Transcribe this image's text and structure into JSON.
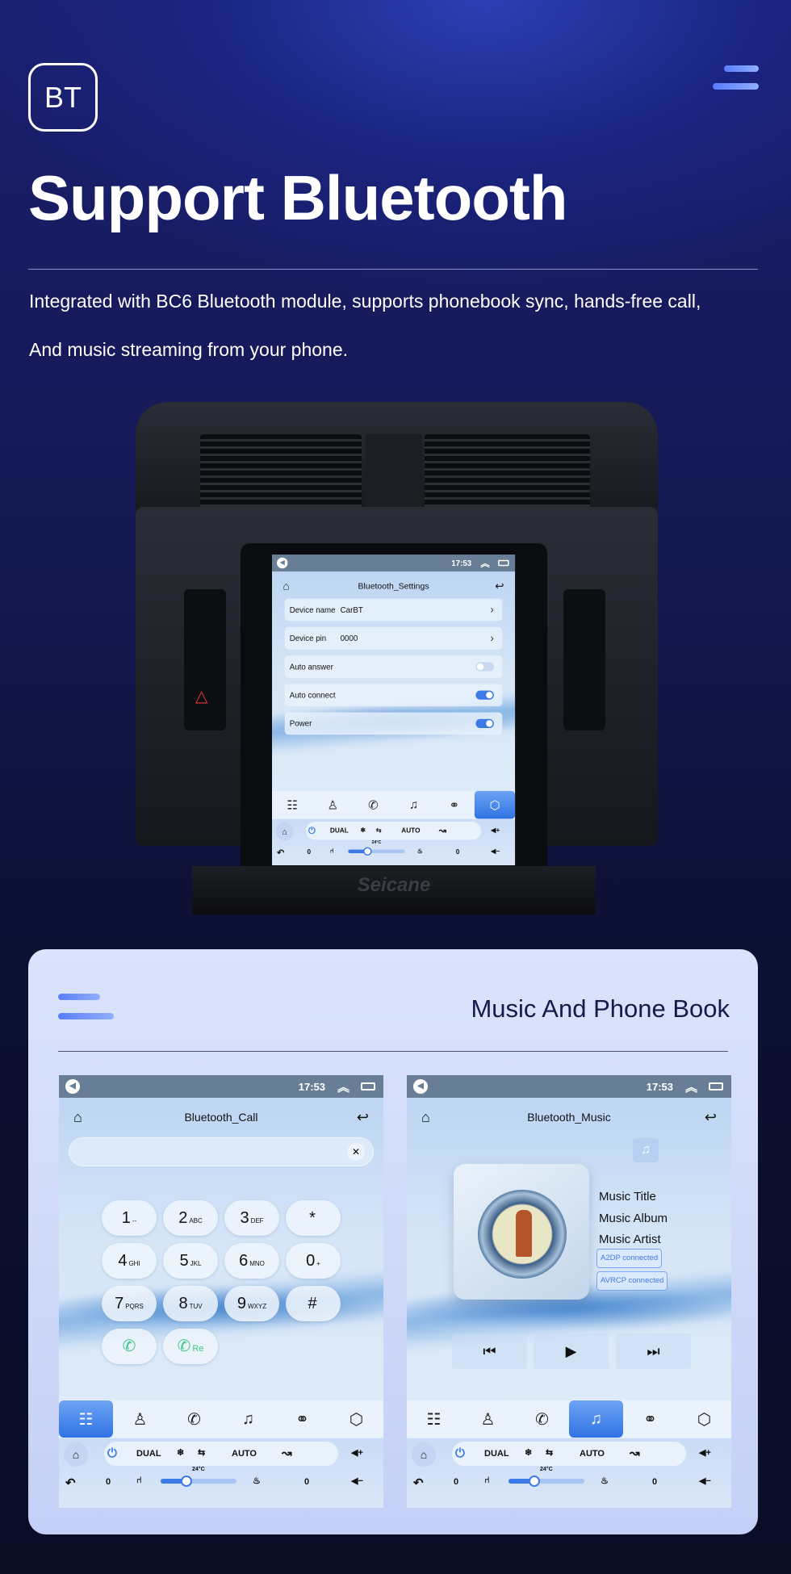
{
  "header": {
    "badge": "BT",
    "title": "Support Bluetooth",
    "lines": [
      "Integrated with BC6 Bluetooth module, supports phonebook sync, hands-free call,",
      "And music streaming from your phone."
    ]
  },
  "colors": {
    "accent": "#3c7be6",
    "background": "#141851",
    "card": "#d3dcf9"
  },
  "car": {
    "brand": "Seicane"
  },
  "chrome": {
    "time": "17:53",
    "temp": "24°C",
    "dual": "DUAL",
    "auto": "AUTO",
    "left_level": "0",
    "right_level": "0",
    "tab_icons": [
      "grid-icon",
      "contacts-icon",
      "phone-icon",
      "music-icon",
      "link-icon",
      "settings-icon"
    ]
  },
  "settings": {
    "title": "Bluetooth_Settings",
    "rows": [
      {
        "label": "Device name",
        "value": "CarBT"
      },
      {
        "label": "Device pin",
        "value": "0000"
      },
      {
        "label": "Auto answer",
        "toggle": false
      },
      {
        "label": "Auto connect",
        "toggle": true
      },
      {
        "label": "Power",
        "toggle": true
      }
    ],
    "active_tab": 5
  },
  "section": {
    "title": "Music And Phone Book"
  },
  "call": {
    "title": "Bluetooth_Call",
    "input_value": "",
    "keys": [
      [
        "1",
        "--"
      ],
      [
        "2",
        "ABC"
      ],
      [
        "3",
        "DEF"
      ],
      [
        "*",
        ""
      ],
      [
        "4",
        "GHI"
      ],
      [
        "5",
        "JKL"
      ],
      [
        "6",
        "MNO"
      ],
      [
        "0",
        "+"
      ],
      [
        "7",
        "PQRS"
      ],
      [
        "8",
        "TUV"
      ],
      [
        "9",
        "WXYZ"
      ],
      [
        "#",
        ""
      ]
    ],
    "redial": "Re",
    "active_tab": 0
  },
  "music": {
    "title": "Bluetooth_Music",
    "track_title": "Music Title",
    "album": "Music Album",
    "artist": "Music Artist",
    "a2dp": "A2DP connected",
    "avrcp": "AVRCP connected",
    "active_tab": 3
  }
}
